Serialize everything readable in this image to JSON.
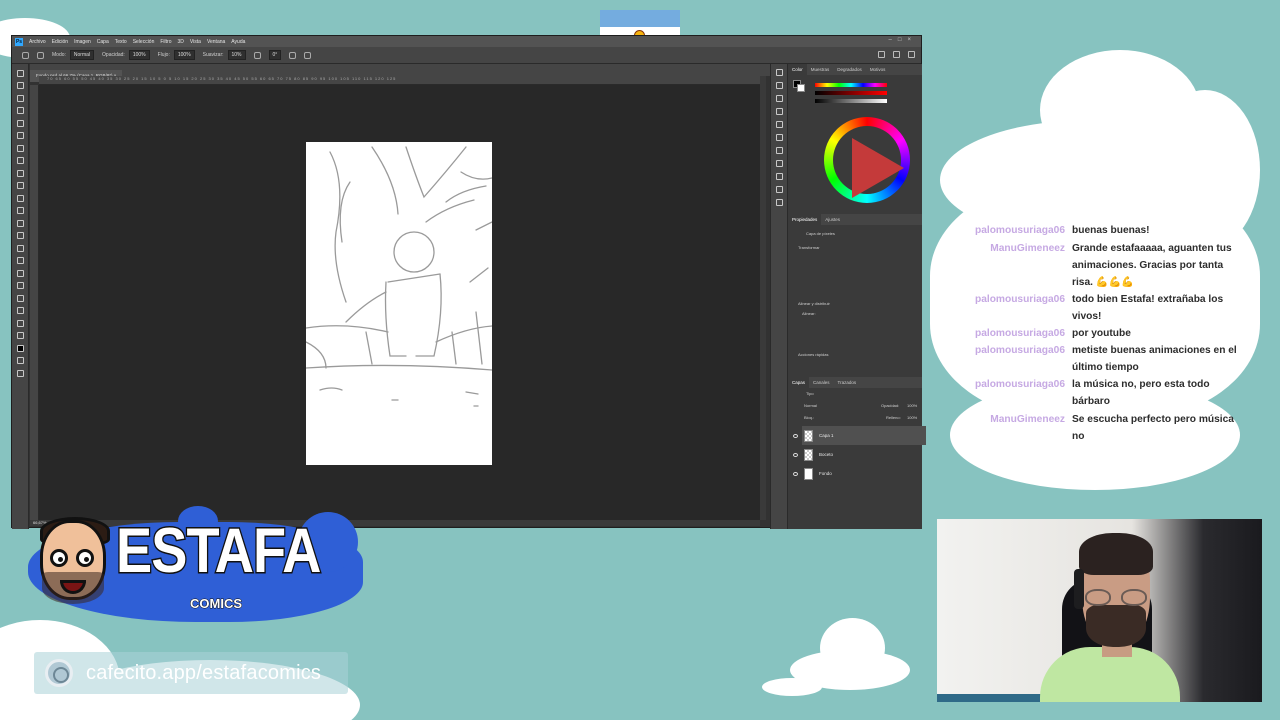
{
  "photoshop": {
    "logo_text": "Ps",
    "menu": [
      "Archivo",
      "Edición",
      "Imagen",
      "Capa",
      "Texto",
      "Selección",
      "Filtro",
      "3D",
      "Vista",
      "Ventana",
      "Ayuda"
    ],
    "options": {
      "mode_label": "Modo:",
      "mode_value": "Normal",
      "opacity_label": "Opacidad:",
      "opacity_value": "100%",
      "flow_label": "Flujo:",
      "flow_value": "100%",
      "smoothing_label": "Suavizar:",
      "smoothing_value": "10%",
      "angle_value": "0°"
    },
    "doc_tab": "Fondo.psd al 66,7% (Capa 1, RGB/8*) ×",
    "ruler_ticks": "70 65 60 55 50 45 40 35 30 25 20 15 10 5 0 5 10 15 20 25 30 35 40 45 50 55 60 65 70 75 80 85 90 95 100 105 110 115 120 125",
    "zoom_status": "66,67%",
    "color_tabs": [
      "Color",
      "Muestras",
      "Degradados",
      "Motivos"
    ],
    "properties_tabs": [
      "Propiedades",
      "Ajustes"
    ],
    "properties": {
      "layer_type": "Capa de píxeles",
      "transform": "Transformar",
      "align": "Alinear y distribuir",
      "align_sub": "Alinear:",
      "more": "Acciones rápidas"
    },
    "layers_tabs": [
      "Capas",
      "Canales",
      "Trazados"
    ],
    "layers_controls": {
      "filter": "Tipo",
      "blend": "Normal",
      "opacity_label": "Opacidad:",
      "opacity_value": "100%",
      "lock_label": "Bloq.:",
      "fill_label": "Relleno:",
      "fill_value": "100%"
    },
    "layers": [
      {
        "name": "Capa 1",
        "selected": true,
        "thumb": "checker"
      },
      {
        "name": "Boceto",
        "selected": false,
        "thumb": "checker"
      },
      {
        "name": "Fondo",
        "selected": false,
        "thumb": "white"
      }
    ]
  },
  "chat": [
    {
      "user": "palomousuriaga06",
      "text": "buenas buenas!"
    },
    {
      "user": "ManuGimeneez",
      "text": "Grande estafaaaaa, aguanten tus animaciones. Gracias por tanta risa. 💪💪💪"
    },
    {
      "user": "palomousuriaga06",
      "text": "todo bien Estafa! extrañaba los vivos!"
    },
    {
      "user": "palomousuriaga06",
      "text": "por youtube"
    },
    {
      "user": "palomousuriaga06",
      "text": "metiste buenas animaciones en el último tiempo"
    },
    {
      "user": "palomousuriaga06",
      "text": "la música no, pero esta todo bárbaro"
    },
    {
      "user": "ManuGimeneez",
      "text": "Se escucha perfecto pero música no"
    }
  ],
  "logo": {
    "title": "ESTAFA",
    "subtitle": "COMICS"
  },
  "cafecito": {
    "text": "cafecito.app/estafacomics"
  },
  "colors": {
    "background": "#87c3c0",
    "chat_user": "#c6a9e3",
    "logo_blue": "#2f5fd6",
    "flag_blue": "#74acdf"
  }
}
